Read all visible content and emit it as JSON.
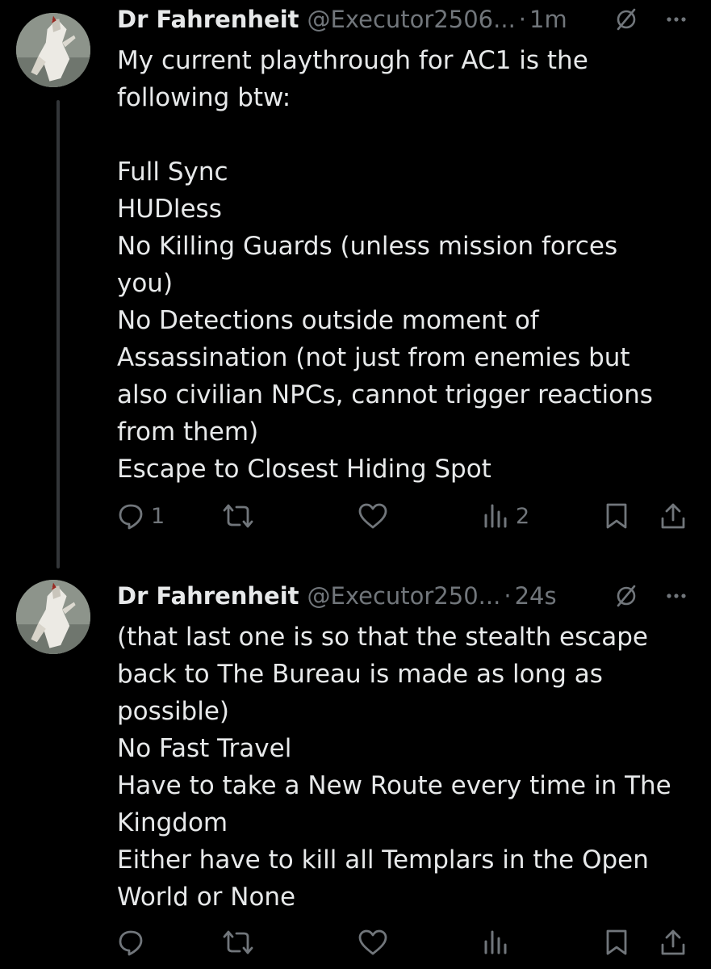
{
  "tweets": [
    {
      "author_name": "Dr Fahrenheit",
      "handle": "@Executor2506...",
      "separator": "·",
      "time": "1m",
      "text": "My current playthrough for AC1 is the\nfollowing btw:\n\nFull Sync\nHUDless\nNo Killing Guards (unless mission forces\nyou)\nNo Detections outside moment of\nAssassination (not just from enemies but\nalso civilian NPCs, cannot trigger reactions\nfrom them)\nEscape to Closest Hiding Spot",
      "stats": {
        "replies": "1",
        "reposts": "",
        "likes": "",
        "views": "2"
      }
    },
    {
      "author_name": "Dr Fahrenheit",
      "handle": "@Executor250...",
      "separator": "·",
      "time": "24s",
      "text": "(that last one is so that the stealth escape\nback to The Bureau is made as long as\npossible)\nNo Fast Travel\nHave to take a New Route every time in The\nKingdom\nEither have to kill all Templars in the Open\nWorld or None",
      "stats": {
        "replies": "",
        "reposts": "",
        "likes": "",
        "views": ""
      }
    }
  ],
  "icons": {
    "avatar": "assassin-avatar",
    "grok": "grok-icon",
    "more": "more-icon",
    "reply": "reply-icon",
    "repost": "repost-icon",
    "like": "heart-icon",
    "views": "views-icon",
    "bookmark": "bookmark-icon",
    "share": "share-icon"
  },
  "colors": {
    "background": "#000000",
    "primary_text": "#e7e9ea",
    "secondary_text": "#71767b",
    "thread_line": "#333639"
  }
}
